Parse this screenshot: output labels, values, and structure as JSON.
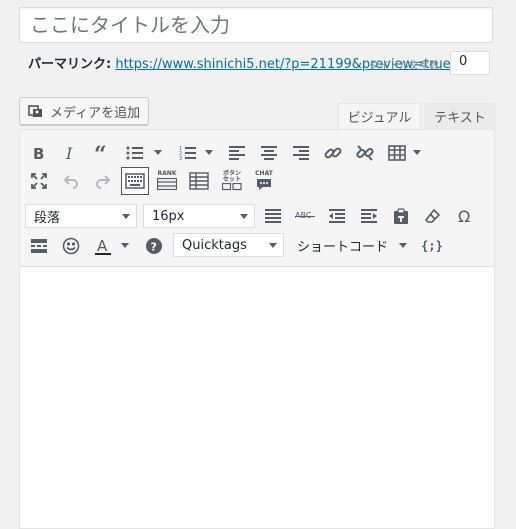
{
  "title": {
    "placeholder": "ここにタイトルを入力"
  },
  "permalink": {
    "label": "パーマリンク:",
    "url": "https://www.shinichi5.net/?p=21199&preview=true",
    "overlap_label": "タイトル文字数:",
    "char_count": "0"
  },
  "media_button": {
    "label": "メディアを追加"
  },
  "tabs": {
    "visual": "ビジュアル",
    "text": "テキスト"
  },
  "toolbar": {
    "format_select": "段落",
    "fontsize_select": "16px",
    "quicktags_select": "Quicktags",
    "shortcode_label": "ショートコード",
    "rank_label": "RANK",
    "button_label_1": "ボタン",
    "button_label_2": "セット",
    "chat_label": "CHAT",
    "strike_label": "ABC",
    "shortcode_brace": "{;}"
  },
  "colors": {
    "link": "#0073aa",
    "icon": "#555d66",
    "accent": "#0073aa"
  }
}
